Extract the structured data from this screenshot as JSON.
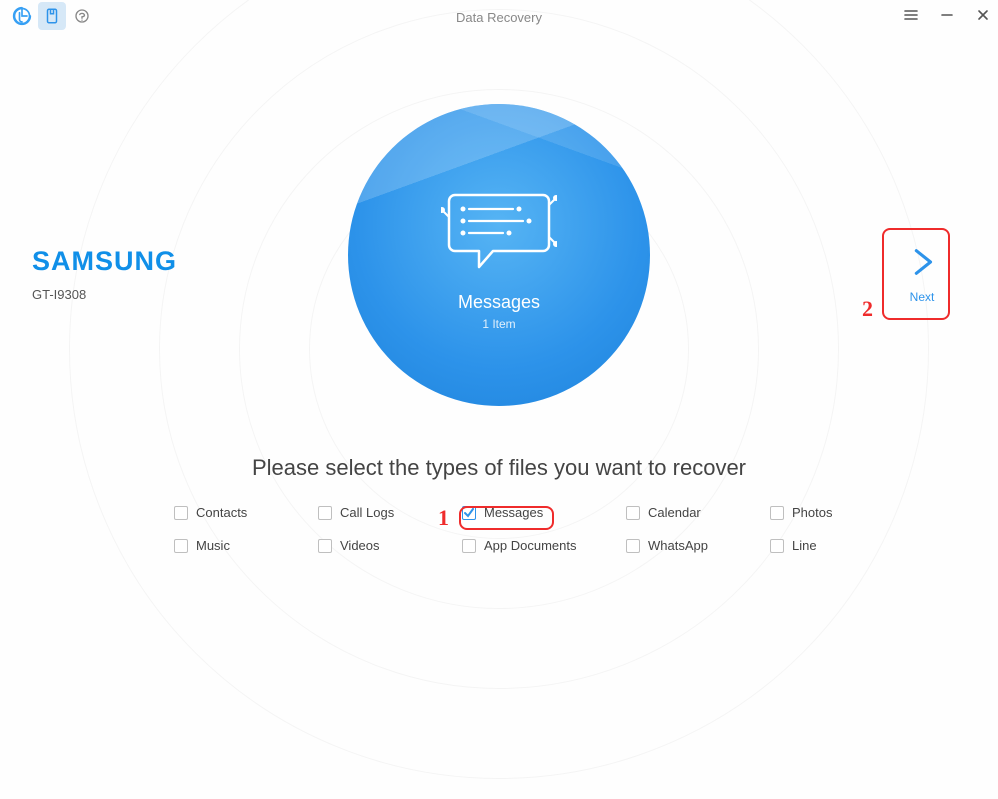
{
  "header": {
    "title": "Data Recovery"
  },
  "device": {
    "brand": "SAMSUNG",
    "model": "GT-I9308"
  },
  "circle": {
    "title": "Messages",
    "subtitle": "1 Item"
  },
  "instruction": "Please select the types of files you want to recover",
  "categories": [
    {
      "label": "Contacts",
      "checked": false
    },
    {
      "label": "Call Logs",
      "checked": false
    },
    {
      "label": "Messages",
      "checked": true
    },
    {
      "label": "Calendar",
      "checked": false
    },
    {
      "label": "Photos",
      "checked": false
    },
    {
      "label": "Music",
      "checked": false
    },
    {
      "label": "Videos",
      "checked": false
    },
    {
      "label": "App Documents",
      "checked": false
    },
    {
      "label": "WhatsApp",
      "checked": false
    },
    {
      "label": "Line",
      "checked": false
    }
  ],
  "next": {
    "label": "Next"
  },
  "annotations": [
    {
      "num": "1"
    },
    {
      "num": "2"
    }
  ]
}
